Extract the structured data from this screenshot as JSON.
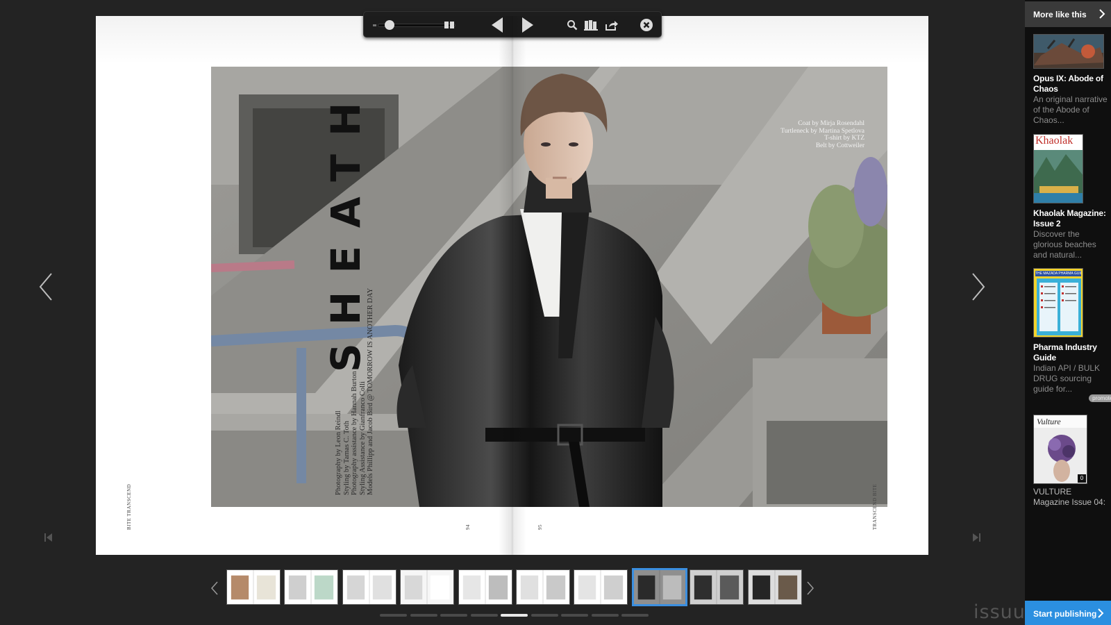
{
  "spread": {
    "title": "SHEATH",
    "credits": [
      "Photography by Leon Reindl",
      "Styling by Tamas C. Toth",
      "Photography assistance by Hannah Burton",
      "Styling Assistance by Gianfranco Colli",
      "Models Phillipp and Jacob Bird @ TOMORROW IS ANOTHER DAY"
    ],
    "wardrobe": [
      "Coat by Mirja Rosendahl",
      "Turtleneck by Martina Spetlova",
      "T-shirt by KTZ",
      "Belt by Cottweiler"
    ],
    "folio_left": "BITE  TRANSCEND",
    "folio_right": "TRANSCEND  BITE",
    "page_left": "94",
    "page_right": "95"
  },
  "toolbar": {
    "zoom_level": 0.1,
    "icons": [
      "zoom-slider",
      "two-page-icon",
      "previous-page-icon",
      "next-page-icon",
      "search-icon",
      "library-icon",
      "share-icon",
      "close-icon"
    ]
  },
  "thumbnails": {
    "count": 10,
    "active_index": 7
  },
  "pager": {
    "dot_count": 9,
    "active_index": 4
  },
  "sidebar": {
    "header": "More like this",
    "items": [
      {
        "title": "Opus IX: Abode of Chaos",
        "desc": "An original narrative of the Abode of Chaos...",
        "promoted": false
      },
      {
        "title": "Khaolak Magazine: Issue 2",
        "desc": "Discover the glorious beaches and natural...",
        "promoted": false,
        "cover_text": "Khaolak"
      },
      {
        "title": "Pharma Industry Guide",
        "desc": "Indian API / BULK DRUG sourcing guide for...",
        "promoted": true,
        "promoted_label": "promoted",
        "cover_text": "THE MAZADA PHARMA GUIDE"
      },
      {
        "title": "",
        "desc": "VULTURE Magazine Issue 04:",
        "promoted": false,
        "cover_text": "Vulture",
        "page_count": "0"
      }
    ],
    "cta": "Start publishing"
  },
  "brand": "issuu",
  "colors": {
    "background": "#232323",
    "sidebar": "#0f0f0f",
    "accent": "#2b8fe0",
    "active_thumb": "#3b8fe0"
  }
}
